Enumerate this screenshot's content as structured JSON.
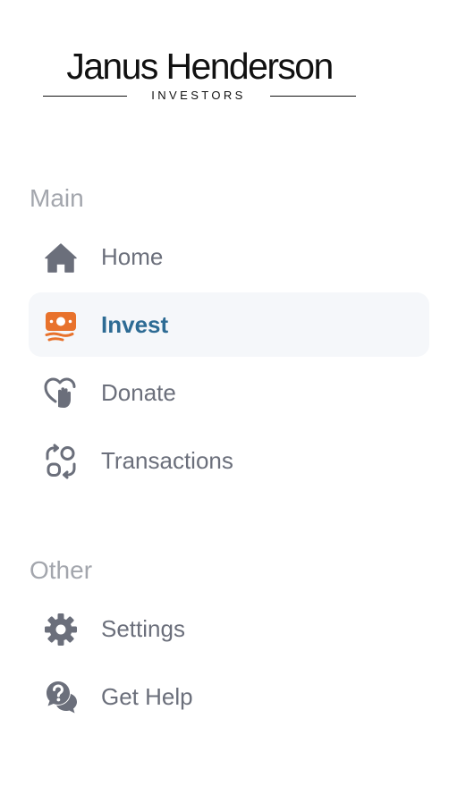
{
  "brand": {
    "name": "Janus Henderson",
    "subtitle": "INVESTORS"
  },
  "sections": {
    "main_label": "Main",
    "other_label": "Other"
  },
  "nav": {
    "home": "Home",
    "invest": "Invest",
    "donate": "Donate",
    "transactions": "Transactions",
    "settings": "Settings",
    "help": "Get Help"
  },
  "active_item": "invest",
  "colors": {
    "active_text": "#2d6b94",
    "active_icon": "#e8722c",
    "active_background": "#f5f7fa",
    "inactive_text": "#6b6f7b",
    "inactive_icon": "#6b6f7b",
    "section_label": "#a3a6ad"
  },
  "icons": {
    "home": "home-icon",
    "invest": "money-hand-icon",
    "donate": "heart-hand-icon",
    "transactions": "transactions-icon",
    "settings": "gear-icon",
    "help": "help-chat-icon"
  }
}
